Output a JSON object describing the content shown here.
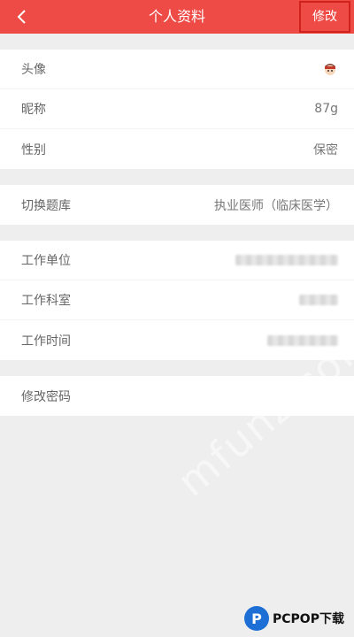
{
  "header": {
    "title": "个人资料",
    "edit_label": "修改",
    "background_color": "#ee4b46"
  },
  "profile": {
    "avatar_label": "头像",
    "nickname_label": "昵称",
    "nickname_value": "87g",
    "gender_label": "性别",
    "gender_value": "保密"
  },
  "exam": {
    "switch_label": "切换题库",
    "switch_value": "执业医师（临床医学）"
  },
  "work": {
    "unit_label": "工作单位",
    "dept_label": "工作科室",
    "time_label": "工作时间"
  },
  "security": {
    "password_label": "修改密码"
  },
  "overlay": {
    "watermark": "mfunz.com",
    "logo_text": "PCPOP下载"
  }
}
